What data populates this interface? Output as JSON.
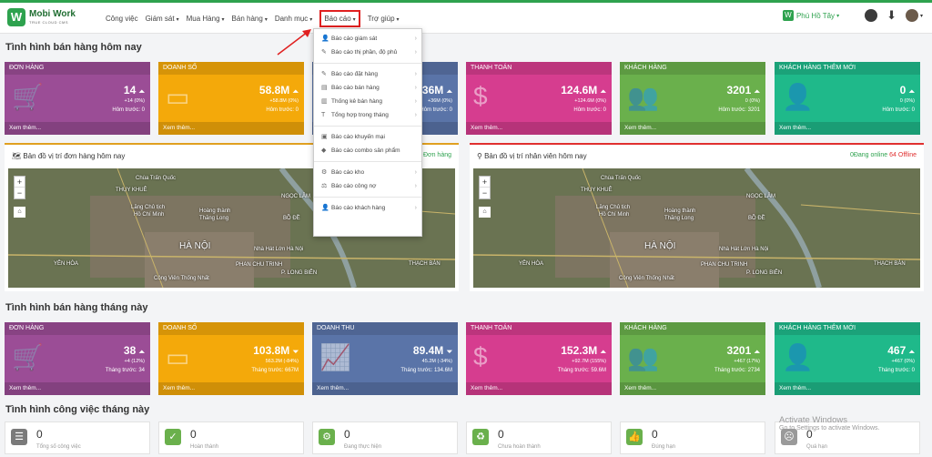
{
  "brand": {
    "name": "Mobi Work",
    "tagline": "TRUE CLOUD CMS"
  },
  "nav": {
    "items": [
      {
        "label": "Công việc",
        "caret": false
      },
      {
        "label": "Giám sát",
        "caret": true
      },
      {
        "label": "Mua Hàng",
        "caret": true
      },
      {
        "label": "Bán hàng",
        "caret": true
      },
      {
        "label": "Danh mục",
        "caret": true
      },
      {
        "label": "Báo cáo",
        "caret": true
      },
      {
        "label": "Trợ giúp",
        "caret": true
      }
    ],
    "branch": "Phú Hồ Tây"
  },
  "dropdown": [
    {
      "label": "Báo cáo giám sát",
      "icon": "user-icon",
      "sub": true
    },
    {
      "label": "Báo cáo thị phần, độ phủ",
      "icon": "edit-icon",
      "sub": true
    },
    {
      "label": "Báo cáo đặt hàng",
      "icon": "edit-icon",
      "sub": true
    },
    {
      "label": "Báo cáo bán hàng",
      "icon": "sales-icon",
      "sub": true
    },
    {
      "label": "Thống kê bán hàng",
      "icon": "chart-icon",
      "sub": true
    },
    {
      "label": "Tổng hợp trong tháng",
      "icon": "text-icon",
      "sub": true
    },
    {
      "label": "Báo cáo khuyến mại",
      "icon": "promo-icon",
      "sub": false
    },
    {
      "label": "Báo cáo combo sản phẩm",
      "icon": "combo-icon",
      "sub": false
    },
    {
      "label": "Báo cáo kho",
      "icon": "warehouse-icon",
      "sub": true
    },
    {
      "label": "Báo cáo công nợ",
      "icon": "debt-icon",
      "sub": true
    },
    {
      "label": "Báo cáo khách hàng",
      "icon": "customer-icon",
      "sub": true
    }
  ],
  "today": {
    "title": "Tình hình bán hàng hôm nay",
    "cards": [
      {
        "title": "ĐƠN HÀNG",
        "value": "14",
        "change": "+14 (0%)",
        "prev": "Hôm trước: 0",
        "more": "Xem thêm...",
        "color": "#9b4d96",
        "icon": "cart-icon"
      },
      {
        "title": "DOANH SỐ",
        "value": "58.8M",
        "change": "+58.8M (0%)",
        "prev": "Hôm trước: 0",
        "more": "Xem thêm...",
        "color": "#f4a90a",
        "icon": "card-icon"
      },
      {
        "title": "",
        "value": "36M",
        "change": "+36M (0%)",
        "prev": "Hôm trước: 0",
        "more": "",
        "color": "#5a74a8",
        "icon": "chart-icon"
      },
      {
        "title": "THANH TOÁN",
        "value": "124.6M",
        "change": "+124.6M (0%)",
        "prev": "Hôm trước: 0",
        "more": "Xem thêm...",
        "color": "#d63d8f",
        "icon": "dollar-icon"
      },
      {
        "title": "KHÁCH HÀNG",
        "value": "3201",
        "change": "0 (0%)",
        "prev": "Hôm trước: 3201",
        "more": "Xem thêm...",
        "color": "#6ab04c",
        "icon": "group-icon"
      },
      {
        "title": "KHÁCH HÀNG THÊM MỚI",
        "value": "0",
        "change": "0 (0%)",
        "prev": "Hôm trước: 0",
        "more": "Xem thêm...",
        "color": "#1fb98a",
        "icon": "add-user-icon"
      }
    ]
  },
  "maps": {
    "orders": {
      "title": "Bản đồ vị trí đơn hàng hôm nay",
      "right": "Đơn hàng"
    },
    "staff": {
      "title": "Bản đồ vị trí nhân viên hôm nay",
      "online": "0Đang online",
      "offline": "64 Offline"
    },
    "labels": [
      "Chùa Trấn Quốc",
      "THỤY KHUÊ",
      "Lăng Chủ tịch",
      "Hồ Chí Minh",
      "Hoàng thành",
      "Thăng Long",
      "HÀ NỘI",
      "YÊN HÒA",
      "PHAN CHU TRINH",
      "THẠCH BÀN",
      "Công Viên Thống Nhất",
      "NGỌC LÂM",
      "BỒ ĐỀ",
      "P. LONG BIÊN",
      "Nhà Hát Lớn Hà Nội"
    ]
  },
  "month": {
    "title": "Tình hình bán hàng tháng này",
    "cards": [
      {
        "title": "ĐƠN HÀNG",
        "value": "38",
        "change": "+4 (12%)",
        "prev": "Tháng trước: 34",
        "more": "Xem thêm...",
        "color": "#9b4d96",
        "icon": "cart-icon"
      },
      {
        "title": "DOANH SỐ",
        "value": "103.8M",
        "change": "563.2M (-84%)",
        "prev": "Tháng trước: 667M",
        "more": "Xem thêm...",
        "color": "#f4a90a",
        "icon": "card-icon"
      },
      {
        "title": "DOANH THU",
        "value": "89.4M",
        "change": "45.2M (-34%)",
        "prev": "Tháng trước: 134.6M",
        "more": "Xem thêm...",
        "color": "#5a74a8",
        "icon": "trend-icon"
      },
      {
        "title": "THANH TOÁN",
        "value": "152.3M",
        "change": "+92.7M (155%)",
        "prev": "Tháng trước: 59.6M",
        "more": "Xem thêm...",
        "color": "#d63d8f",
        "icon": "dollar-icon"
      },
      {
        "title": "KHÁCH HÀNG",
        "value": "3201",
        "change": "+467 (17%)",
        "prev": "Tháng trước: 2734",
        "more": "Xem thêm...",
        "color": "#6ab04c",
        "icon": "group-icon"
      },
      {
        "title": "KHÁCH HÀNG THÊM MỚI",
        "value": "467",
        "change": "+467 (0%)",
        "prev": "Tháng trước: 0",
        "more": "Xem thêm...",
        "color": "#1fb98a",
        "icon": "add-user-icon"
      }
    ]
  },
  "work": {
    "title": "Tình hình công việc tháng này",
    "tiles": [
      {
        "value": "0",
        "label": "Tổng số công việc",
        "color": "#7a7a7a",
        "icon": "tasks-icon"
      },
      {
        "value": "0",
        "label": "Hoàn thành",
        "color": "#6ab04c",
        "icon": "calendar-check-icon"
      },
      {
        "value": "0",
        "label": "Đang thực hiện",
        "color": "#6ab04c",
        "icon": "gears-icon"
      },
      {
        "value": "0",
        "label": "Chưa hoàn thành",
        "color": "#6ab04c",
        "icon": "recycle-icon"
      },
      {
        "value": "0",
        "label": "Đúng hạn",
        "color": "#6ab04c",
        "icon": "thumbs-up-icon"
      },
      {
        "value": "0",
        "label": "Quá hạn",
        "color": "#9a9a9a",
        "icon": "frown-icon"
      }
    ]
  },
  "watermark": {
    "line1": "Activate Windows",
    "line2": "Go to Settings to activate Windows."
  }
}
